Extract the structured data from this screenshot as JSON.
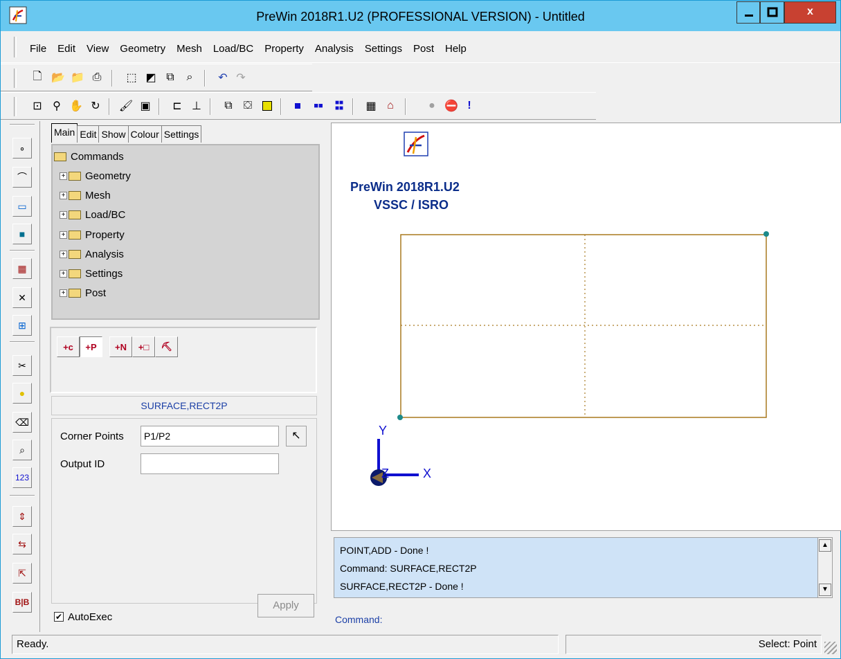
{
  "window": {
    "title": "PreWin 2018R1.U2 (PROFESSIONAL VERSION) - Untitled",
    "close_label": "x"
  },
  "menu": [
    "File",
    "Edit",
    "View",
    "Geometry",
    "Mesh",
    "Load/BC",
    "Property",
    "Analysis",
    "Settings",
    "Post",
    "Help"
  ],
  "tabs": [
    "Main",
    "Edit",
    "Show",
    "Colour",
    "Settings"
  ],
  "tree": {
    "root": "Commands",
    "children": [
      "Geometry",
      "Mesh",
      "Load/BC",
      "Property",
      "Analysis",
      "Settings",
      "Post"
    ]
  },
  "command_buttons": [
    {
      "label": "+c"
    },
    {
      "label": "+P"
    },
    {
      "label": "+N"
    },
    {
      "label": "+□"
    },
    {
      "label": "⛏"
    }
  ],
  "command_name": "SURFACE,RECT2P",
  "form": {
    "corner_points_label": "Corner Points",
    "corner_points_value": "P1/P2",
    "output_id_label": "Output ID",
    "output_id_value": ""
  },
  "autoexec": {
    "label": "AutoExec",
    "checked": true
  },
  "apply_label": "Apply",
  "canvas": {
    "brand_line1": "PreWin 2018R1.U2",
    "brand_line2": "VSSC / ISRO",
    "axis_x": "X",
    "axis_y": "Y",
    "axis_z": "Z",
    "rect_color": "#a8781e",
    "point_color": "#1d8a8a"
  },
  "messages": [
    "POINT,ADD - Done !",
    "Command: SURFACE,RECT2P",
    "SURFACE,RECT2P - Done !"
  ],
  "command_prompt": "Command:",
  "status": {
    "left": "Ready.",
    "right": "Select: Point"
  },
  "colors": {
    "titlebar": "#69c8f0",
    "message_bg": "#cfe3f7",
    "brand": "#0b2d8a"
  }
}
